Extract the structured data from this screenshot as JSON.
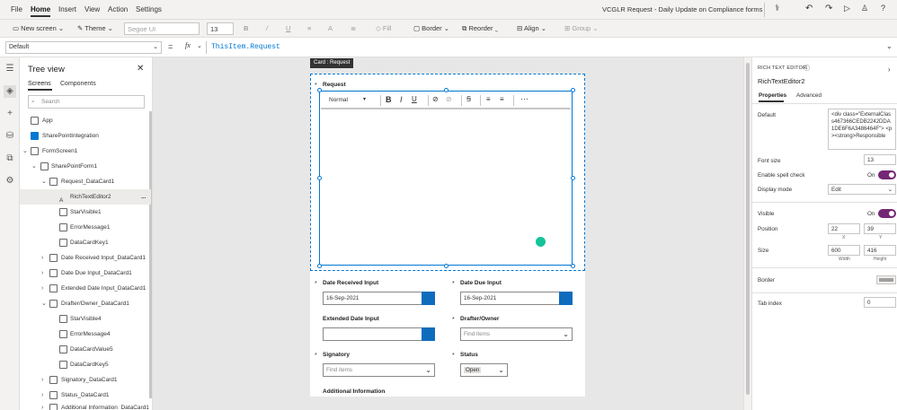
{
  "menu": {
    "file": "File",
    "home": "Home",
    "insert": "Insert",
    "view": "View",
    "action": "Action",
    "settings": "Settings"
  },
  "app_title": "VCGLR Request - Daily Update on Compliance forms",
  "toolbar": {
    "new_screen": "New screen",
    "theme": "Theme",
    "font": "Segoe UI",
    "font_size": "13",
    "bold": "B",
    "fill": "Fill",
    "border": "Border",
    "reorder": "Reorder",
    "align": "Align",
    "group": "Group"
  },
  "formula": {
    "property": "Default",
    "fx": "fx",
    "expression": "ThisItem.Request"
  },
  "tree": {
    "title": "Tree view",
    "tab_screens": "Screens",
    "tab_components": "Components",
    "search_placeholder": "Search",
    "items": [
      {
        "label": "App"
      },
      {
        "label": "SharePointIntegration"
      },
      {
        "label": "FormScreen1"
      },
      {
        "label": "SharePointForm1"
      },
      {
        "label": "Request_DataCard1"
      },
      {
        "label": "RichTextEditor2"
      },
      {
        "label": "StarVisible1"
      },
      {
        "label": "ErrorMessage1"
      },
      {
        "label": "DataCardKey1"
      },
      {
        "label": "Date Received Input_DataCard1"
      },
      {
        "label": "Date Due Input_DataCard1"
      },
      {
        "label": "Extended Date Input_DataCard1"
      },
      {
        "label": "Drafter/Owner_DataCard1"
      },
      {
        "label": "StarVisible4"
      },
      {
        "label": "ErrorMessage4"
      },
      {
        "label": "DataCardValue5"
      },
      {
        "label": "DataCardKey5"
      },
      {
        "label": "Signatory_DataCard1"
      },
      {
        "label": "Status_DataCard1"
      },
      {
        "label": "Additional Information_DataCard1"
      }
    ],
    "more": "..."
  },
  "canvas": {
    "tooltip": "Card : Request",
    "request_label": "Request",
    "rte_style": "Normal",
    "date_received_label": "Date Received Input",
    "date_received_value": "16-Sep-2021",
    "date_due_label": "Date Due Input",
    "date_due_value": "16-Sep-2021",
    "extended_label": "Extended Date Input",
    "drafter_label": "Drafter/Owner",
    "drafter_placeholder": "Find items",
    "signatory_label": "Signatory",
    "signatory_placeholder": "Find items",
    "status_label": "Status",
    "status_value": "Open",
    "additional_label": "Additional Information",
    "required_star": "*"
  },
  "props": {
    "type": "RICH TEXT EDITOR",
    "name": "RichTextEditor2",
    "tab_properties": "Properties",
    "tab_advanced": "Advanced",
    "default_label": "Default",
    "default_value": "<div class=\"ExternalClass467366CEDB2242DDA1DE6F6A3486464F\"> <p><strong>Responsible",
    "font_size_label": "Font size",
    "font_size_value": "13",
    "spell_label": "Enable spell check",
    "spell_value": "On",
    "display_label": "Display mode",
    "display_value": "Edit",
    "visible_label": "Visible",
    "visible_value": "On",
    "position_label": "Position",
    "pos_x": "22",
    "pos_y": "39",
    "x_caption": "X",
    "y_caption": "Y",
    "size_label": "Size",
    "width": "600",
    "height": "416",
    "width_caption": "Width",
    "height_caption": "Height",
    "border_label": "Border",
    "tab_index_label": "Tab index",
    "tab_index_value": "0"
  },
  "colors": {
    "accent": "#742774",
    "select": "#0078d4",
    "calendar": "#0f6cbd"
  }
}
